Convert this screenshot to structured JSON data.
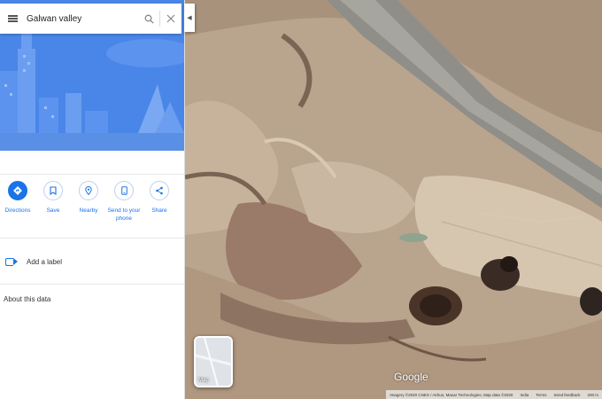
{
  "search": {
    "value": "Galwan valley"
  },
  "actions": [
    {
      "label": "Directions",
      "icon": "directions-icon",
      "filled": true
    },
    {
      "label": "Save",
      "icon": "bookmark-icon",
      "filled": false
    },
    {
      "label": "Nearby",
      "icon": "nearby-pin-icon",
      "filled": false
    },
    {
      "label": "Send to your phone",
      "icon": "phone-icon",
      "filled": false
    },
    {
      "label": "Share",
      "icon": "share-icon",
      "filled": false
    }
  ],
  "add_label": "Add a label",
  "about": "About this data",
  "map": {
    "thumb_label": "Map",
    "logo": "Google",
    "attribution": {
      "imagery": "Imagery ©2020 CNES / Airbus, Maxar Technologies, Map data ©2020",
      "country": "India",
      "terms": "Terms",
      "feedback": "Send feedback",
      "scale": "200 m"
    }
  },
  "colors": {
    "accent": "#1a73e8",
    "hero_bg": "#4a86e8"
  }
}
